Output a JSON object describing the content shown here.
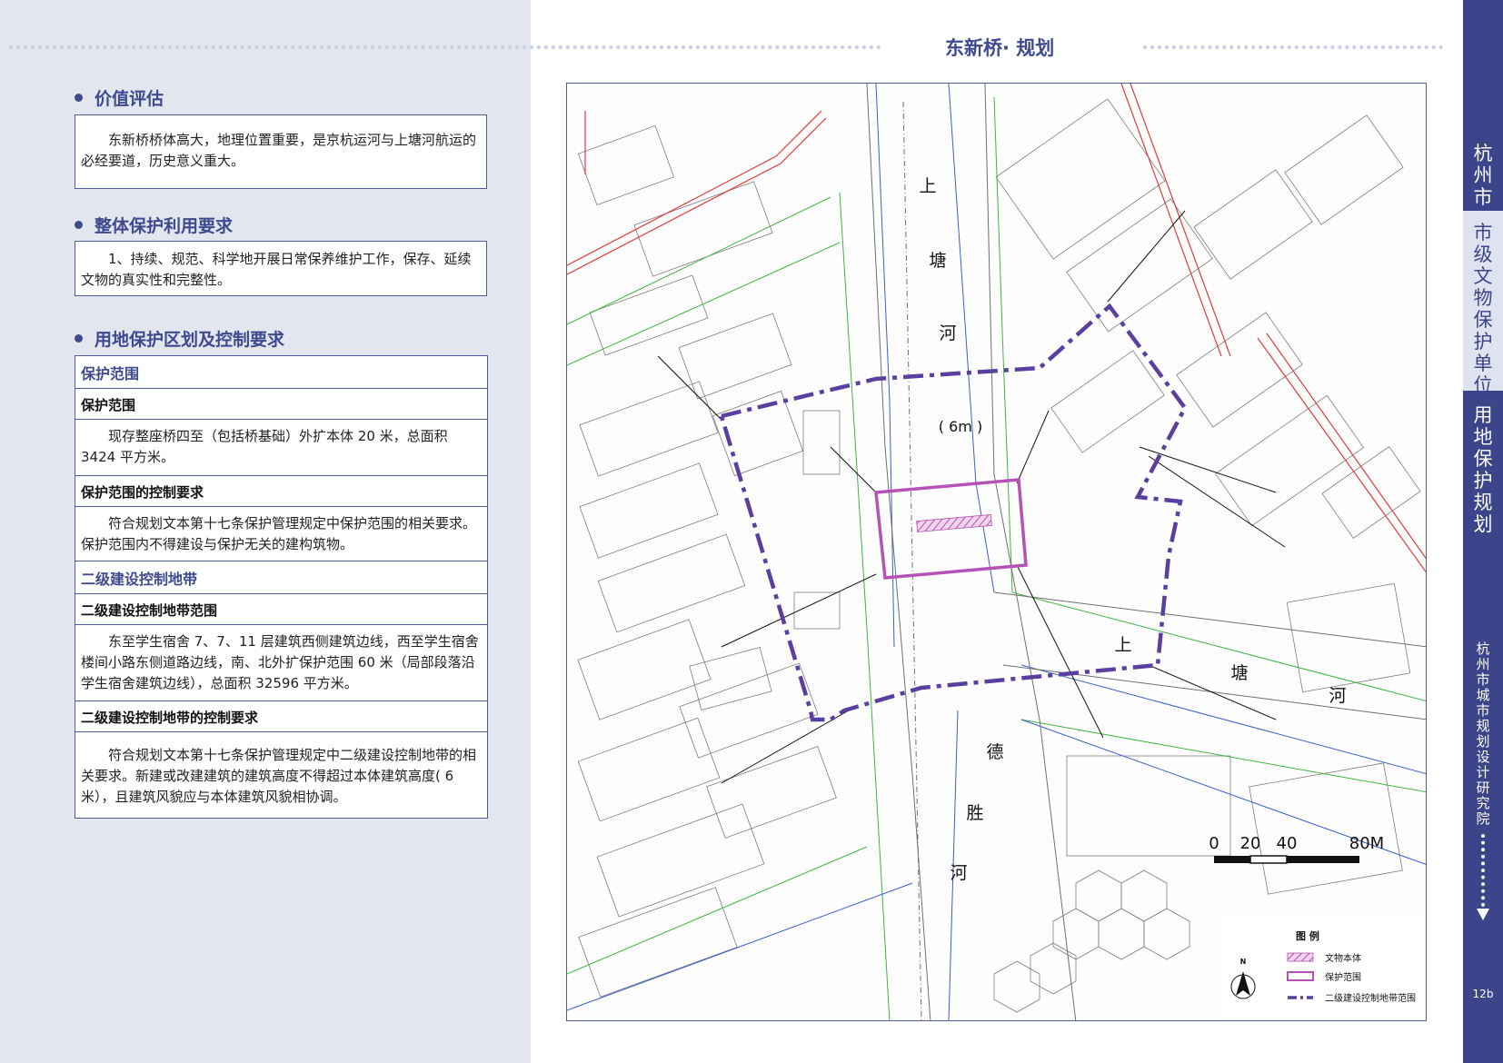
{
  "header": {
    "title": "东新桥· 规划"
  },
  "sections": [
    {
      "title": "价值评估",
      "text": "东新桥桥体高大，地理位置重要，是京杭运河与上塘河航运的必经要道，历史意义重大。"
    },
    {
      "title": "整体保护利用要求",
      "text": "1、持续、规范、科学地开展日常保养维护工作，保存、延续文物的真实性和完整性。"
    },
    {
      "title": "用地保护区划及控制要求"
    }
  ],
  "table": {
    "rows": [
      {
        "kind": "hdr",
        "text": "保护范围"
      },
      {
        "kind": "sub",
        "text": "保护范围"
      },
      {
        "kind": "txt",
        "text": "现存整座桥四至（包括桥基础）外扩本体 20 米，总面积 3424 平方米。"
      },
      {
        "kind": "sub",
        "text": "保护范围的控制要求"
      },
      {
        "kind": "txt",
        "text": "符合规划文本第十七条保护管理规定中保护范围的相关要求。保护范围内不得建设与保护无关的建构筑物。"
      },
      {
        "kind": "hdr",
        "text": "二级建设控制地带"
      },
      {
        "kind": "sub",
        "text": "二级建设控制地带范围"
      },
      {
        "kind": "txt",
        "text": "东至学生宿舍 7、7、11 层建筑西侧建筑边线，西至学生宿舍楼间小路东侧道路边线，南、北外扩保护范围 60 米（局部段落沿学生宿舍建筑边线），总面积 32596 平方米。"
      },
      {
        "kind": "sub",
        "text": "二级建设控制地带的控制要求"
      },
      {
        "kind": "txt",
        "text": "符合规划文本第十七条保护管理规定中二级建设控制地带的相关要求。新建或改建建筑的建筑高度不得超过本体建筑高度( 6米），且建筑风貌应与本体建筑风貌相协调。"
      }
    ]
  },
  "sidebar": {
    "city": "杭州市",
    "category": "市级文物保护单位",
    "section": "用地保护规划",
    "institute": "杭州市城市规划设计研究院",
    "page": "12b"
  },
  "map": {
    "river_shangtang_1": [
      "上",
      "塘",
      "河"
    ],
    "river_width": "( 6m )",
    "river_shangtang_2": [
      "上",
      "塘",
      "河"
    ],
    "river_desheng": [
      "德",
      "胜",
      "河"
    ],
    "scale_labels": [
      "0",
      "20",
      "40",
      "80M"
    ],
    "north": "N",
    "legend_title": "图  例",
    "legend_items": [
      "文物本体",
      "保护范围",
      "二级建设控制地带范围"
    ]
  },
  "colors": {
    "accent": "#3e4a8e",
    "sidebar": "#3c4589",
    "protect": "#b552b5",
    "control": "#5b3f9e"
  }
}
